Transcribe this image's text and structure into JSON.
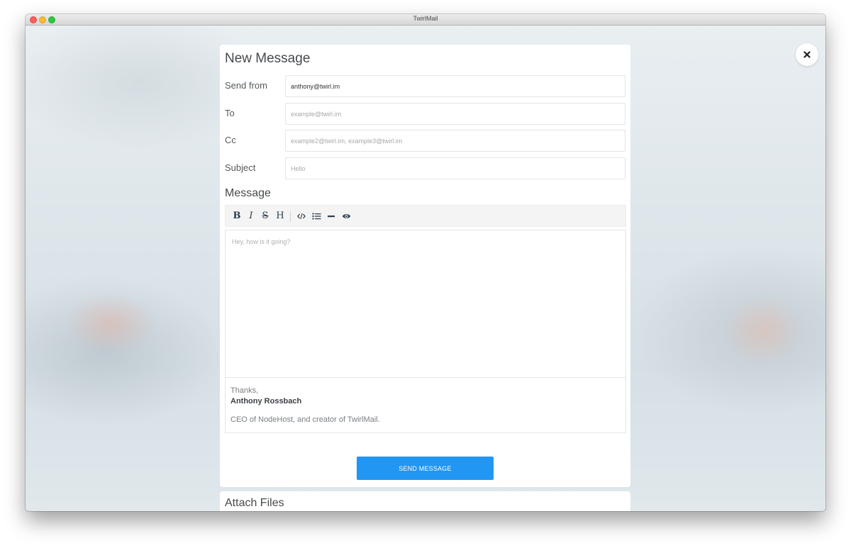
{
  "window": {
    "title": "TwirlMail"
  },
  "compose": {
    "title": "New Message",
    "fields": {
      "from": {
        "label": "Send from",
        "value": "anthony@twirl.im",
        "placeholder": ""
      },
      "to": {
        "label": "To",
        "value": "",
        "placeholder": "example@twirl.im"
      },
      "cc": {
        "label": "Cc",
        "value": "",
        "placeholder": "example2@twirl.im, example3@twirl.im"
      },
      "subject": {
        "label": "Subject",
        "value": "",
        "placeholder": "Hello"
      }
    },
    "message": {
      "heading": "Message",
      "body_value": "",
      "placeholder": "Hey, how is it going?",
      "toolbar": [
        {
          "name": "bold",
          "glyph": "B"
        },
        {
          "name": "italic",
          "glyph": "I"
        },
        {
          "name": "strikethrough",
          "glyph": "S"
        },
        {
          "name": "heading",
          "glyph": "H"
        },
        {
          "name": "code",
          "icon": "code-icon"
        },
        {
          "name": "list",
          "icon": "list-icon"
        },
        {
          "name": "horizontal-rule",
          "icon": "horizontal-rule-icon"
        },
        {
          "name": "preview",
          "icon": "eye-icon"
        }
      ]
    },
    "signature": {
      "greeting": "Thanks,",
      "name": "Anthony Rossbach",
      "title": "CEO of NodeHost, and creator of TwirlMail."
    },
    "send_label": "SEND MESSAGE"
  },
  "attach": {
    "title": "Attach Files"
  },
  "icons": {
    "close": "close-icon"
  },
  "colors": {
    "accent": "#2196f3",
    "toolbar_icon": "#2c3e50",
    "close_red": "#fc5f57",
    "minimize_yellow": "#fdbc2e",
    "maximize_green": "#28c840"
  }
}
